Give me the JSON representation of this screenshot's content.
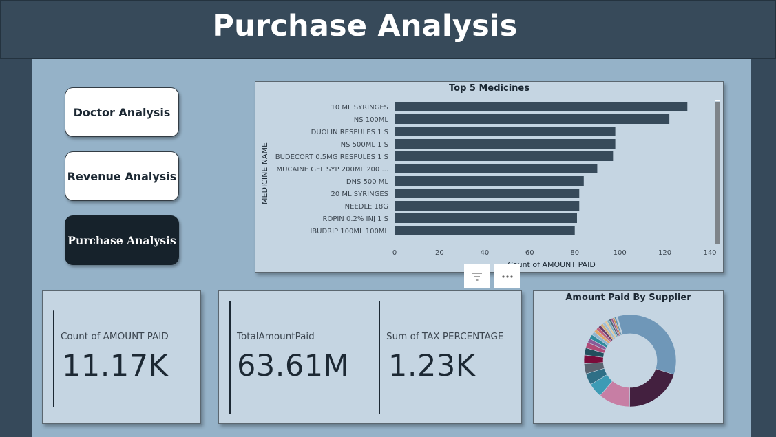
{
  "header": {
    "title": "Purchase Analysis"
  },
  "nav": {
    "buttons": [
      {
        "label": "Doctor Analysis",
        "active": false
      },
      {
        "label": "Revenue Analysis",
        "active": false
      },
      {
        "label": "Purchase Analysis",
        "active": true
      }
    ]
  },
  "bar_chart": {
    "title": "Top 5 Medicines",
    "ylabel": "MEDICINE NAME",
    "xlabel": "Count of AMOUNT PAID",
    "ticks": [
      "0",
      "20",
      "40",
      "60",
      "80",
      "100",
      "120",
      "140"
    ]
  },
  "kpis": {
    "count_label": "Count of AMOUNT PAID",
    "count_value": "11.17K",
    "total_label": "TotalAmountPaid",
    "total_value": "63.61M",
    "tax_label": "Sum of TAX PERCENTAGE",
    "tax_value": "1.23K"
  },
  "donut": {
    "title": "Amount Paid By Supplier"
  },
  "chart_data": [
    {
      "type": "bar",
      "orientation": "horizontal",
      "title": "Top 5 Medicines",
      "xlabel": "Count of AMOUNT PAID",
      "ylabel": "MEDICINE NAME",
      "categories": [
        "10 ML SYRINGES",
        "NS 100ML",
        "DUOLIN RESPULES 1 S",
        "NS 500ML 1 S",
        "BUDECORT 0.5MG RESPULES 1 S",
        "MUCAINE GEL SYP 200ML 200 ...",
        "DNS 500 ML",
        "20 ML SYRINGES",
        "NEEDLE 18G",
        "ROPIN 0.2% INJ 1 S",
        "IBUDRIP 100ML 100ML"
      ],
      "values": [
        130,
        122,
        98,
        98,
        97,
        90,
        84,
        82,
        82,
        81,
        80
      ],
      "xlim": [
        0,
        140
      ],
      "bar_color": "#374a5a"
    },
    {
      "type": "pie",
      "donut": true,
      "title": "Amount Paid By Supplier",
      "values": [
        34,
        20,
        11,
        5,
        4,
        3.5,
        3,
        2.5,
        2,
        1.5,
        1.5,
        1.2,
        1.2,
        1,
        1,
        0.9,
        0.9,
        0.8,
        0.8,
        0.7,
        0.7,
        0.6,
        0.6,
        0.5
      ],
      "colors": [
        "#6f97b8",
        "#43203f",
        "#c77ea4",
        "#3d9bb5",
        "#2f6f86",
        "#5a6470",
        "#7a0c3a",
        "#234f5d",
        "#b04a77",
        "#8a5a98",
        "#2e8a9c",
        "#91b6cf",
        "#e0a46a",
        "#c15f7a",
        "#6c3b69",
        "#d6b07a",
        "#9fbcd3",
        "#e3c89a",
        "#7dafc0",
        "#4d6677",
        "#a15b86",
        "#d08a4a",
        "#5e8fa8",
        "#b9cbd8"
      ]
    }
  ]
}
